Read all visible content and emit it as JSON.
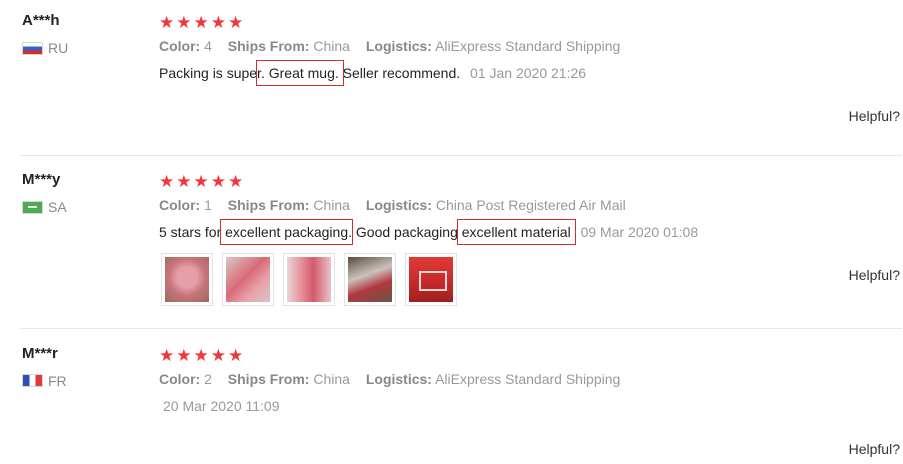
{
  "reviews": [
    {
      "user": "A***h",
      "country": "RU",
      "stars": [
        "★",
        "★",
        "★",
        "★",
        "★"
      ],
      "color_label": "Color:",
      "color_value": "4",
      "ships_label": "Ships From:",
      "ships_value": "China",
      "logistics_label": "Logistics:",
      "logistics_value": "AliExpress Standard Shipping",
      "text_part1": "Packing is super",
      "text_hl1": ". Great mug.",
      "text_part2": " Seller recommend.",
      "date": "01 Jan 2020 21:26",
      "helpful": "Helpful?"
    },
    {
      "user": "M***y",
      "country": "SA",
      "stars": [
        "★",
        "★",
        "★",
        "★",
        "★"
      ],
      "color_label": "Color:",
      "color_value": "1",
      "ships_label": "Ships From:",
      "ships_value": "China",
      "logistics_label": "Logistics:",
      "logistics_value": "China Post Registered Air Mail",
      "text_part1": "5 stars for ",
      "text_hl1": "excellent packaging",
      "text_part2": ". Good packaging ",
      "text_hl2": "excellent material",
      "date": "09 Mar 2020 01:08",
      "helpful": "Helpful?"
    },
    {
      "user": "M***r",
      "country": "FR",
      "stars": [
        "★",
        "★",
        "★",
        "★",
        "★"
      ],
      "color_label": "Color:",
      "color_value": "2",
      "ships_label": "Ships From:",
      "ships_value": "China",
      "logistics_label": "Logistics:",
      "logistics_value": "AliExpress Standard Shipping",
      "date": "20 Mar 2020 11:09",
      "helpful": "Helpful?"
    }
  ],
  "colors": {
    "star": "#f0383c",
    "highlight_box": "#c8302a"
  }
}
